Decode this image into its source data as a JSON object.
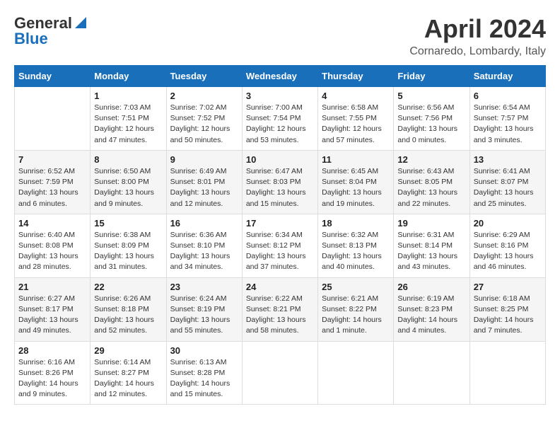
{
  "header": {
    "logo_line1": "General",
    "logo_line2": "Blue",
    "title": "April 2024",
    "subtitle": "Cornaredo, Lombardy, Italy"
  },
  "columns": [
    "Sunday",
    "Monday",
    "Tuesday",
    "Wednesday",
    "Thursday",
    "Friday",
    "Saturday"
  ],
  "weeks": [
    [
      {
        "day": "",
        "info": ""
      },
      {
        "day": "1",
        "info": "Sunrise: 7:03 AM\nSunset: 7:51 PM\nDaylight: 12 hours\nand 47 minutes."
      },
      {
        "day": "2",
        "info": "Sunrise: 7:02 AM\nSunset: 7:52 PM\nDaylight: 12 hours\nand 50 minutes."
      },
      {
        "day": "3",
        "info": "Sunrise: 7:00 AM\nSunset: 7:54 PM\nDaylight: 12 hours\nand 53 minutes."
      },
      {
        "day": "4",
        "info": "Sunrise: 6:58 AM\nSunset: 7:55 PM\nDaylight: 12 hours\nand 57 minutes."
      },
      {
        "day": "5",
        "info": "Sunrise: 6:56 AM\nSunset: 7:56 PM\nDaylight: 13 hours\nand 0 minutes."
      },
      {
        "day": "6",
        "info": "Sunrise: 6:54 AM\nSunset: 7:57 PM\nDaylight: 13 hours\nand 3 minutes."
      }
    ],
    [
      {
        "day": "7",
        "info": "Sunrise: 6:52 AM\nSunset: 7:59 PM\nDaylight: 13 hours\nand 6 minutes."
      },
      {
        "day": "8",
        "info": "Sunrise: 6:50 AM\nSunset: 8:00 PM\nDaylight: 13 hours\nand 9 minutes."
      },
      {
        "day": "9",
        "info": "Sunrise: 6:49 AM\nSunset: 8:01 PM\nDaylight: 13 hours\nand 12 minutes."
      },
      {
        "day": "10",
        "info": "Sunrise: 6:47 AM\nSunset: 8:03 PM\nDaylight: 13 hours\nand 15 minutes."
      },
      {
        "day": "11",
        "info": "Sunrise: 6:45 AM\nSunset: 8:04 PM\nDaylight: 13 hours\nand 19 minutes."
      },
      {
        "day": "12",
        "info": "Sunrise: 6:43 AM\nSunset: 8:05 PM\nDaylight: 13 hours\nand 22 minutes."
      },
      {
        "day": "13",
        "info": "Sunrise: 6:41 AM\nSunset: 8:07 PM\nDaylight: 13 hours\nand 25 minutes."
      }
    ],
    [
      {
        "day": "14",
        "info": "Sunrise: 6:40 AM\nSunset: 8:08 PM\nDaylight: 13 hours\nand 28 minutes."
      },
      {
        "day": "15",
        "info": "Sunrise: 6:38 AM\nSunset: 8:09 PM\nDaylight: 13 hours\nand 31 minutes."
      },
      {
        "day": "16",
        "info": "Sunrise: 6:36 AM\nSunset: 8:10 PM\nDaylight: 13 hours\nand 34 minutes."
      },
      {
        "day": "17",
        "info": "Sunrise: 6:34 AM\nSunset: 8:12 PM\nDaylight: 13 hours\nand 37 minutes."
      },
      {
        "day": "18",
        "info": "Sunrise: 6:32 AM\nSunset: 8:13 PM\nDaylight: 13 hours\nand 40 minutes."
      },
      {
        "day": "19",
        "info": "Sunrise: 6:31 AM\nSunset: 8:14 PM\nDaylight: 13 hours\nand 43 minutes."
      },
      {
        "day": "20",
        "info": "Sunrise: 6:29 AM\nSunset: 8:16 PM\nDaylight: 13 hours\nand 46 minutes."
      }
    ],
    [
      {
        "day": "21",
        "info": "Sunrise: 6:27 AM\nSunset: 8:17 PM\nDaylight: 13 hours\nand 49 minutes."
      },
      {
        "day": "22",
        "info": "Sunrise: 6:26 AM\nSunset: 8:18 PM\nDaylight: 13 hours\nand 52 minutes."
      },
      {
        "day": "23",
        "info": "Sunrise: 6:24 AM\nSunset: 8:19 PM\nDaylight: 13 hours\nand 55 minutes."
      },
      {
        "day": "24",
        "info": "Sunrise: 6:22 AM\nSunset: 8:21 PM\nDaylight: 13 hours\nand 58 minutes."
      },
      {
        "day": "25",
        "info": "Sunrise: 6:21 AM\nSunset: 8:22 PM\nDaylight: 14 hours\nand 1 minute."
      },
      {
        "day": "26",
        "info": "Sunrise: 6:19 AM\nSunset: 8:23 PM\nDaylight: 14 hours\nand 4 minutes."
      },
      {
        "day": "27",
        "info": "Sunrise: 6:18 AM\nSunset: 8:25 PM\nDaylight: 14 hours\nand 7 minutes."
      }
    ],
    [
      {
        "day": "28",
        "info": "Sunrise: 6:16 AM\nSunset: 8:26 PM\nDaylight: 14 hours\nand 9 minutes."
      },
      {
        "day": "29",
        "info": "Sunrise: 6:14 AM\nSunset: 8:27 PM\nDaylight: 14 hours\nand 12 minutes."
      },
      {
        "day": "30",
        "info": "Sunrise: 6:13 AM\nSunset: 8:28 PM\nDaylight: 14 hours\nand 15 minutes."
      },
      {
        "day": "",
        "info": ""
      },
      {
        "day": "",
        "info": ""
      },
      {
        "day": "",
        "info": ""
      },
      {
        "day": "",
        "info": ""
      }
    ]
  ]
}
